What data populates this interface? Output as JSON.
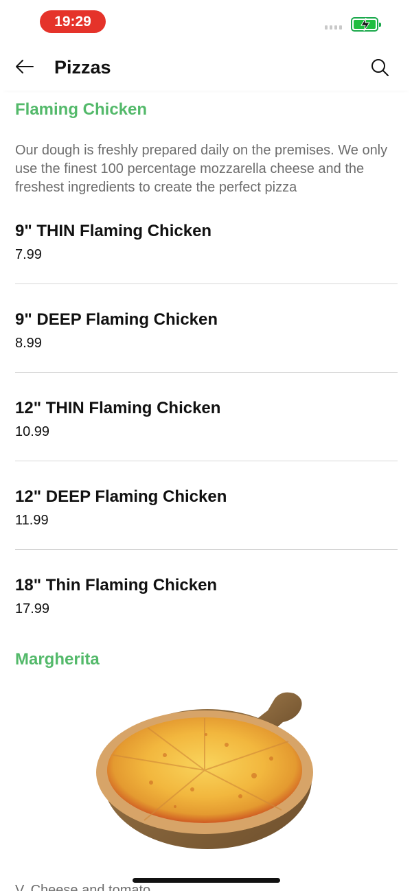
{
  "status_bar": {
    "time": "19:29",
    "battery_color": "#1fbe3f",
    "time_pill_color": "#e5332a"
  },
  "header": {
    "title": "Pizzas",
    "back_icon": "arrow-left-icon",
    "search_icon": "search-icon"
  },
  "accent_color": "#53b96a",
  "sections": [
    {
      "title": "Flaming Chicken",
      "description": "Our dough is freshly prepared daily on the premises. We only use the finest 100 percentage mozzarella cheese and the freshest ingredients to create the perfect pizza",
      "items": [
        {
          "name": "9\" THIN Flaming Chicken",
          "price": "7.99"
        },
        {
          "name": "9\" DEEP Flaming Chicken",
          "price": "8.99"
        },
        {
          "name": "12\" THIN Flaming Chicken",
          "price": "10.99"
        },
        {
          "name": "12\" DEEP Flaming Chicken",
          "price": "11.99"
        },
        {
          "name": "18\" Thin Flaming Chicken",
          "price": "17.99"
        }
      ]
    },
    {
      "title": "Margherita",
      "image": "pizza-on-wooden-board",
      "description_partial": "V, Cheese and tomato"
    }
  ]
}
